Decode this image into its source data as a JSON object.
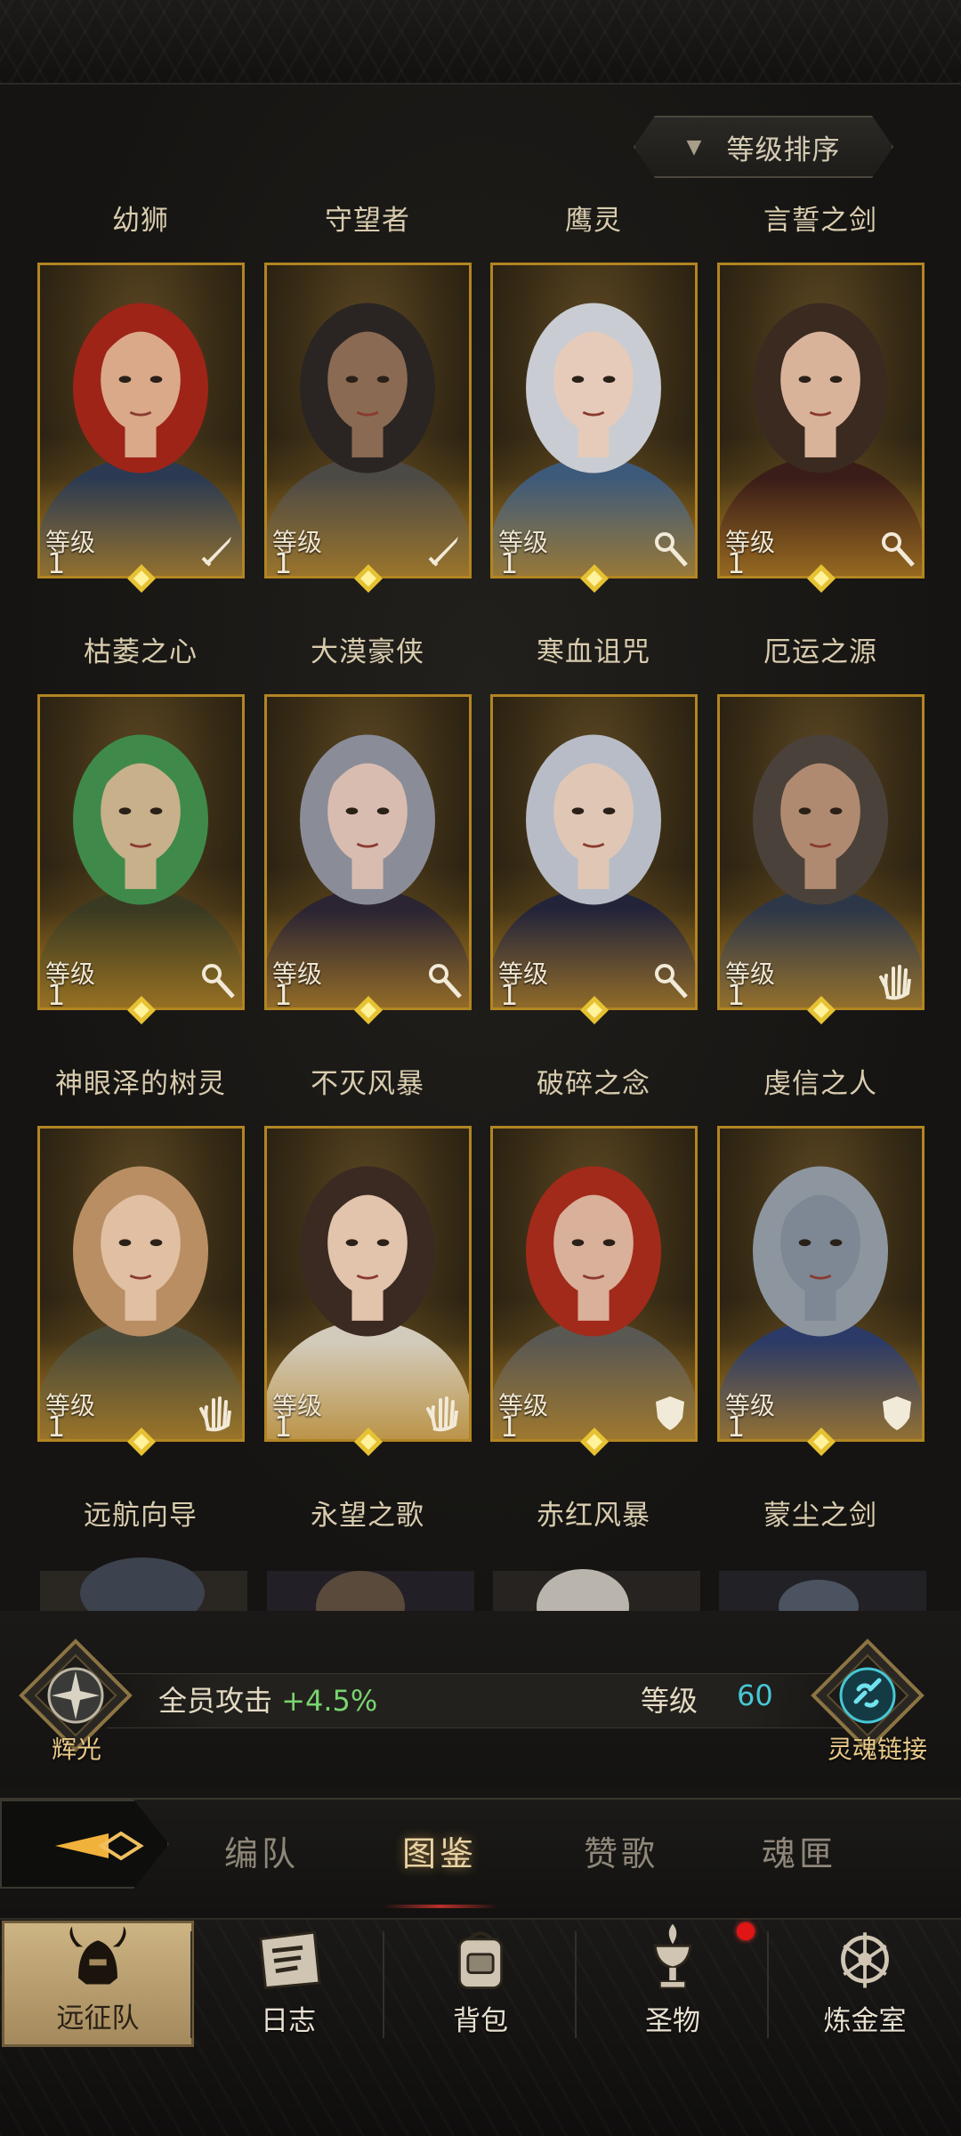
{
  "sort_button": {
    "label": "等级排序"
  },
  "level_label": "等级",
  "heroes": [
    {
      "name": "幼狮",
      "level": "1",
      "class_icon": "sword-icon",
      "portrait": {
        "hair": "#9e2418",
        "skin": "#d9a98a",
        "robe": "#2b3a52"
      }
    },
    {
      "name": "守望者",
      "level": "1",
      "class_icon": "sword-icon",
      "portrait": {
        "hair": "#2a2522",
        "skin": "#8a6a52",
        "robe": "#4c4a45"
      }
    },
    {
      "name": "鹰灵",
      "level": "1",
      "class_icon": "staff-icon",
      "portrait": {
        "hair": "#c9ccd2",
        "skin": "#e6cbbb",
        "robe": "#3e5a7a"
      }
    },
    {
      "name": "言誓之剑",
      "level": "1",
      "class_icon": "staff-icon",
      "portrait": {
        "hair": "#3a2a20",
        "skin": "#d8b39a",
        "robe": "#3a1c18"
      }
    },
    {
      "name": "枯萎之心",
      "level": "1",
      "class_icon": "staff-icon",
      "portrait": {
        "hair": "#3f8a4a",
        "skin": "#c7b08a",
        "robe": "#3a3a22"
      }
    },
    {
      "name": "大漠豪侠",
      "level": "1",
      "class_icon": "staff-icon",
      "portrait": {
        "hair": "#8a8d98",
        "skin": "#d9bcb0",
        "robe": "#2a2433"
      }
    },
    {
      "name": "寒血诅咒",
      "level": "1",
      "class_icon": "staff-icon",
      "portrait": {
        "hair": "#b8bcc6",
        "skin": "#e0c7b5",
        "robe": "#23243a"
      }
    },
    {
      "name": "厄运之源",
      "level": "1",
      "class_icon": "palm-icon",
      "portrait": {
        "hair": "#4a423a",
        "skin": "#b08a70",
        "robe": "#2e3748"
      }
    },
    {
      "name": "神眼泽的树灵",
      "level": "1",
      "class_icon": "palm-icon",
      "portrait": {
        "hair": "#b98e63",
        "skin": "#e0bfa2",
        "robe": "#4a4a3a"
      }
    },
    {
      "name": "不灭风暴",
      "level": "1",
      "class_icon": "palm-icon",
      "portrait": {
        "hair": "#3a2a22",
        "skin": "#e2c3ab",
        "robe": "#d2cbbb"
      }
    },
    {
      "name": "破碎之念",
      "level": "1",
      "class_icon": "shield-icon",
      "portrait": {
        "hair": "#a22a1a",
        "skin": "#d9b09a",
        "robe": "#5a5852"
      }
    },
    {
      "name": "虔信之人",
      "level": "1",
      "class_icon": "shield-icon",
      "portrait": {
        "hair": "#8d959f",
        "skin": "#7e8794",
        "robe": "#2b3a66"
      }
    }
  ],
  "next_row_names": [
    "远航向导",
    "永望之歌",
    "赤红风暴",
    "蒙尘之剑"
  ],
  "bonus": {
    "left_emblem_label": "辉光",
    "stat_label": "全员攻击",
    "stat_value": "+4.5%",
    "level_label": "等级",
    "level_value": "60",
    "right_emblem_label": "灵魂链接"
  },
  "tabs": [
    {
      "label": "编队",
      "active": false
    },
    {
      "label": "图鉴",
      "active": true
    },
    {
      "label": "赞歌",
      "active": false
    },
    {
      "label": "魂匣",
      "active": false
    }
  ],
  "bottom_nav": [
    {
      "label": "远征队",
      "icon": "helmet-icon",
      "active": true
    },
    {
      "label": "日志",
      "icon": "scroll-icon",
      "active": false
    },
    {
      "label": "背包",
      "icon": "backpack-icon",
      "active": false
    },
    {
      "label": "圣物",
      "icon": "chalice-icon",
      "active": false
    },
    {
      "label": "炼金室",
      "icon": "alchemy-icon",
      "active": false
    }
  ],
  "colors": {
    "accent_gold": "#b28522",
    "bonus_green": "#79d46f",
    "level_cyan": "#46c8d6",
    "notification_red": "#e01515"
  }
}
